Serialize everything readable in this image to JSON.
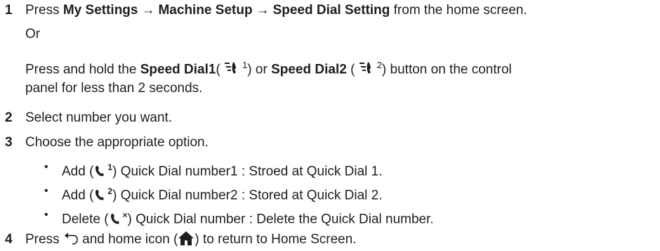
{
  "steps": [
    {
      "number": "1",
      "parts": [
        "Press",
        "My Settings",
        "→",
        "Machine Setup",
        "→",
        "Speed Dial Setting",
        "from the home screen."
      ],
      "or": "Or",
      "alt_parts": [
        "Press and hold the",
        "Speed Dial1",
        "(",
        "1",
        ") or",
        "Speed Dial2",
        "(",
        "2",
        ") button on the control"
      ],
      "alt_cont": "panel for less than 2 seconds."
    },
    {
      "number": "2",
      "text": "Select number you want."
    },
    {
      "number": "3",
      "text": "Choose the appropriate option.",
      "options": [
        {
          "pre": "Add (",
          "sup": "1",
          "post": ") Quick Dial number1 : Stroed at Quick Dial 1."
        },
        {
          "pre": "Add (",
          "sup": "2",
          "post": ") Quick Dial number2 : Stored at Quick Dial 2."
        },
        {
          "pre": "Delete (",
          "sup": "×",
          "post": ") Quick Dial number : Delete the Quick Dial number."
        }
      ]
    },
    {
      "number": "4",
      "pre": "Press",
      "mid": "and home icon (",
      "post": ") to return to Home Screen."
    }
  ],
  "icons": {
    "speed_dial": "speed-dial-icon",
    "phone": "phone-icon",
    "back": "back-icon",
    "home": "home-icon"
  },
  "colors": {
    "text": "#1e1e1e",
    "background": "#ffffff"
  }
}
